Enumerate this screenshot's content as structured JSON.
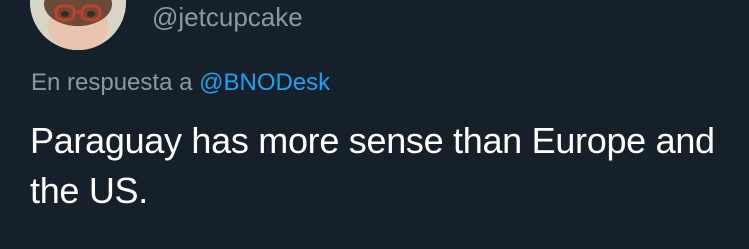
{
  "tweet": {
    "handle": "@jetcupcake",
    "reply_prefix": "En respuesta a",
    "reply_mention": "@BNODesk",
    "text": "Paraguay has more sense than Europe and the US."
  },
  "colors": {
    "background": "#15202b",
    "secondary_text": "#8899a6",
    "link": "#1da1f2",
    "primary_text": "#ffffff"
  },
  "icons": {
    "avatar": "profile-photo"
  }
}
